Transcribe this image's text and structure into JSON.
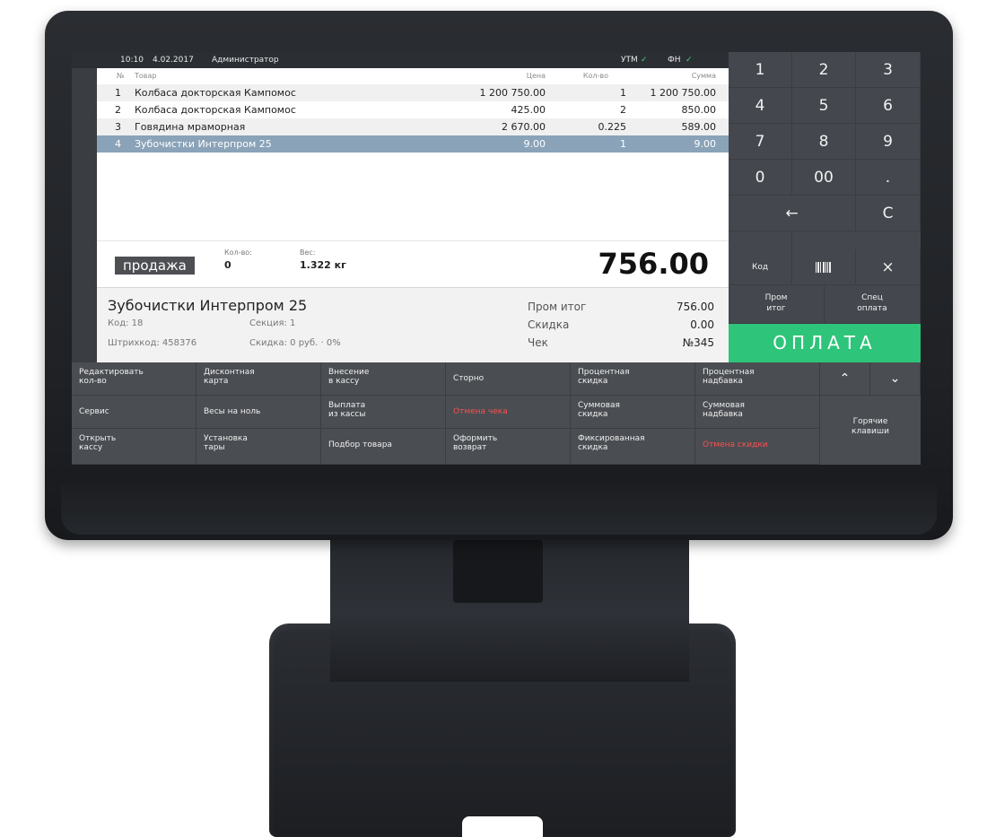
{
  "colors": {
    "accent_pay": "#2ec47a",
    "selected_row": "#8aa3b8",
    "danger_text": "#ff4e4e",
    "check_ok": "#44d37d"
  },
  "status": {
    "time": "10:10",
    "date": "4.02.2017",
    "user": "Администратор",
    "utm": "УТМ",
    "fn": "ФН",
    "check_icon": "check-icon"
  },
  "table": {
    "headers": {
      "num": "№",
      "item": "Товар",
      "price": "Цена",
      "qty": "Кол-во",
      "sum": "Сумма"
    },
    "rows": [
      {
        "num": "1",
        "name": "Колбаса докторская Кампомос",
        "price": "1 200 750.00",
        "qty": "1",
        "sum": "1 200 750.00"
      },
      {
        "num": "2",
        "name": "Колбаса докторская Кампомос",
        "price": "425.00",
        "qty": "2",
        "sum": "850.00"
      },
      {
        "num": "3",
        "name": "Говядина мраморная",
        "price": "2 670.00",
        "qty": "0.225",
        "sum": "589.00"
      },
      {
        "num": "4",
        "name": "Зубочистки Интерпром 25",
        "price": "9.00",
        "qty": "1",
        "sum": "9.00"
      }
    ]
  },
  "totals": {
    "mode": "продажа",
    "qty_label": "Кол-во:",
    "qty_value": "0",
    "weight_label": "Вес:",
    "weight_value": "1.322 кг",
    "grand_total": "756.00"
  },
  "info": {
    "product_name": "Зубочистки Интерпром 25",
    "code": "Код: 18",
    "section": "Секция: 1",
    "barcode": "Штрихкод: 458376",
    "discount": "Скидка: 0 руб. · 0%",
    "subtotal_label": "Пром итог",
    "subtotal_value": "756.00",
    "discount_label": "Скидка",
    "discount_value": "0.00",
    "receipt_label": "Чек",
    "receipt_value": "№345"
  },
  "keypad": {
    "digits": [
      "1",
      "2",
      "3",
      "4",
      "5",
      "6",
      "7",
      "8",
      "9",
      "0",
      "00",
      "."
    ],
    "backspace": "←",
    "clear": "C",
    "code_label": "Код",
    "barcode_icon": "barcode-icon",
    "cancel": "×",
    "subtotal_line1": "Пром",
    "subtotal_line2": "итог",
    "special_line1": "Спец",
    "special_line2": "оплата",
    "pay": "ОПЛАТА"
  },
  "functions": {
    "r1": [
      "Редактировать\nкол-во",
      "Дисконтная\nкарта",
      "Внесение\nв кассу",
      "Сторно",
      "Процентная\nскидка",
      "Процентная\nнадбавка"
    ],
    "r2": [
      "Сервис",
      "Весы на ноль",
      "Выплата\nиз кассы",
      "Отмена чека",
      "Суммовая\nскидка",
      "Суммовая\nнадбавка"
    ],
    "r3": [
      "Открыть\nкассу",
      "Установка\nтары",
      "Подбор товара",
      "Оформить\nвозврат",
      "Фиксированная\nскидка",
      "Отмена скидки"
    ],
    "up": "^",
    "down": "⌄",
    "hotkeys_line1": "Горячие",
    "hotkeys_line2": "клавиши"
  }
}
